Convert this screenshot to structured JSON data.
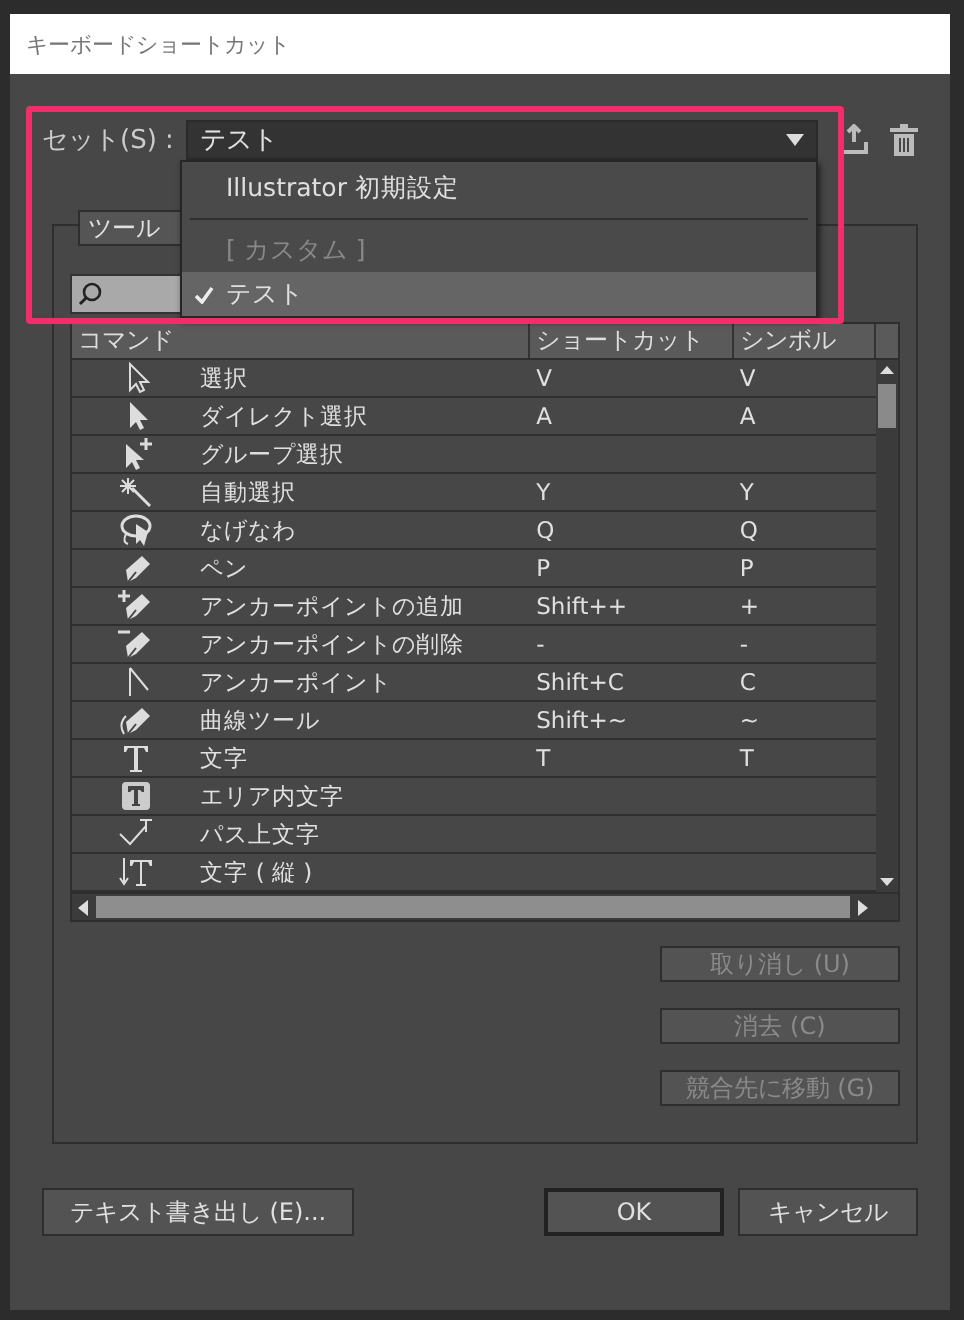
{
  "window": {
    "title": "キーボードショートカット"
  },
  "set": {
    "label": "セット(S) :",
    "value": "テスト"
  },
  "set_menu": [
    {
      "kind": "item",
      "label": "Illustrator 初期設定",
      "disabled": false,
      "checked": false,
      "selected": false
    },
    {
      "kind": "separator"
    },
    {
      "kind": "item",
      "label": "[ カスタム ]",
      "disabled": true,
      "checked": false,
      "selected": false
    },
    {
      "kind": "item",
      "label": "テスト",
      "disabled": false,
      "checked": true,
      "selected": true
    }
  ],
  "category_tab": {
    "label": "ツール"
  },
  "table": {
    "columns": [
      "コマンド",
      "ショートカット",
      "シンボル"
    ],
    "rows": [
      {
        "kind": "selection",
        "command": "選択",
        "shortcut": "V",
        "symbol": "V"
      },
      {
        "kind": "direct",
        "command": "ダイレクト選択",
        "shortcut": "A",
        "symbol": "A"
      },
      {
        "kind": "group",
        "command": "グループ選択"
      },
      {
        "kind": "wand",
        "command": "自動選択",
        "shortcut": "Y",
        "symbol": "Y"
      },
      {
        "kind": "lasso",
        "command": "なげなわ",
        "shortcut": "Q",
        "symbol": "Q"
      },
      {
        "kind": "pen",
        "command": "ペン",
        "shortcut": "P",
        "symbol": "P"
      },
      {
        "kind": "pen-add",
        "command": "アンカーポイントの追加",
        "shortcut": "Shift++",
        "symbol": "+"
      },
      {
        "kind": "pen-delete",
        "command": "アンカーポイントの削除",
        "shortcut": "-",
        "symbol": "-"
      },
      {
        "kind": "anchor",
        "command": "アンカーポイント",
        "shortcut": "Shift+C",
        "symbol": "C"
      },
      {
        "kind": "curvature",
        "command": "曲線ツール",
        "shortcut": "Shift+~",
        "symbol": "~"
      },
      {
        "kind": "type",
        "command": "文字",
        "shortcut": "T",
        "symbol": "T"
      },
      {
        "kind": "area-type",
        "command": "エリア内文字"
      },
      {
        "kind": "path-type",
        "command": "パス上文字"
      },
      {
        "kind": "vertical-type",
        "command": "文字 ( 縦 )"
      }
    ]
  },
  "side_buttons": [
    {
      "label": "取り消し (U)",
      "disabled": true
    },
    {
      "label": "消去 (C)",
      "disabled": true
    },
    {
      "label": "競合先に移動 (G)",
      "disabled": true
    }
  ],
  "footer": {
    "export_button": "テキスト書き出し (E)...",
    "buttons": [
      {
        "label": "OK",
        "default": true
      },
      {
        "label": "キャンセル",
        "default": false
      }
    ]
  }
}
